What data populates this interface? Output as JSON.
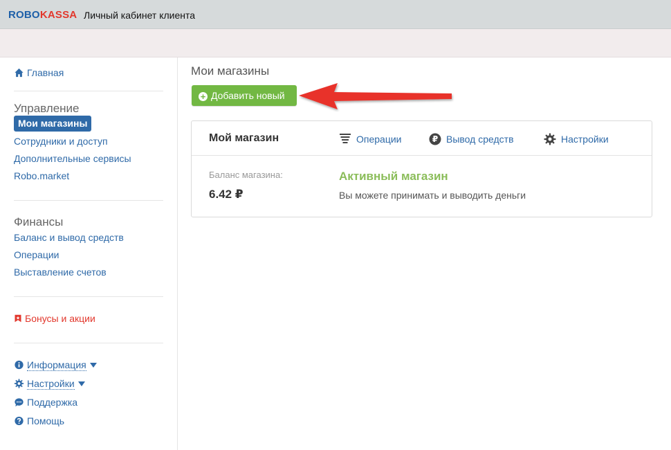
{
  "header": {
    "logo_robo": "ROBO",
    "logo_kassa": "KASSA",
    "title": "Личный кабинет клиента"
  },
  "sidebar": {
    "home": "Главная",
    "management_title": "Управление",
    "management_items": [
      "Мои магазины",
      "Сотрудники и доступ",
      "Дополнительные сервисы",
      "Robo.market"
    ],
    "finance_title": "Финансы",
    "finance_items": [
      "Баланс и вывод средств",
      "Операции",
      "Выставление счетов"
    ],
    "bonus": "Бонусы и акции",
    "info": "Информация",
    "settings": "Настройки",
    "support": "Поддержка",
    "help": "Помощь"
  },
  "main": {
    "heading": "Мои магазины",
    "add_button": "Добавить новый",
    "shop": {
      "name": "Мой магазин",
      "links": [
        "Операции",
        "Вывод средств",
        "Настройки"
      ],
      "balance_label": "Баланс магазина:",
      "balance_value": "6.42 ₽",
      "status": "Активный магазин",
      "status_desc": "Вы можете принимать и выводить деньги"
    }
  },
  "colors": {
    "link": "#2f6aa8",
    "accent_green": "#72b843",
    "status_green": "#8bbd5a",
    "logo_red": "#e2372c",
    "arrow_red": "#e8302a"
  }
}
